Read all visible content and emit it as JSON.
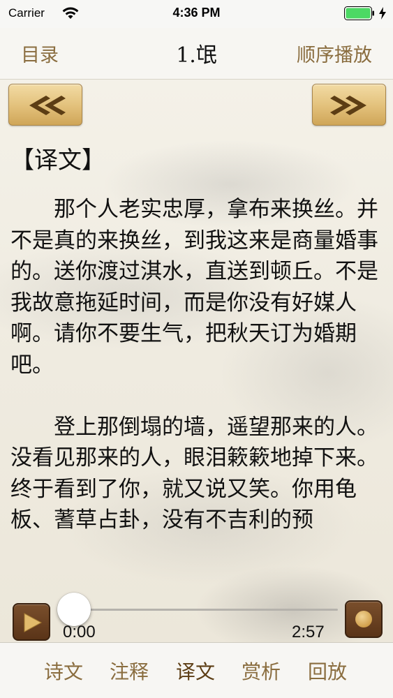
{
  "status_bar": {
    "carrier": "Carrier",
    "time": "4:36 PM",
    "icons": [
      "wifi-icon",
      "battery-icon",
      "charge-icon"
    ],
    "battery_color": "#4cd964"
  },
  "nav": {
    "left_label": "目录",
    "title": "1.氓",
    "right_label": "顺序播放",
    "accent_color": "#8a6d3f"
  },
  "content": {
    "prev_icon": "double-chevron-left-icon",
    "next_icon": "double-chevron-right-icon",
    "heading": "【译文】",
    "paragraphs": [
      "那个人老实忠厚，拿布来换丝。并不是真的来换丝，到我这来是商量婚事的。送你渡过淇水，直送到顿丘。不是我故意拖延时间，而是你没有好媒人啊。请你不要生气，把秋天订为婚期吧。",
      "登上那倒塌的墙，遥望那来的人。没看见那来的人，眼泪簌簌地掉下来。终于看到了你，就又说又笑。你用龟板、蓍草占卦，没有不吉利的预"
    ]
  },
  "player": {
    "current_time": "0:00",
    "total_time": "2:57",
    "progress": 0.0,
    "play_icon": "play-icon",
    "stop_icon": "stop-icon"
  },
  "tabs": [
    {
      "label": "诗文"
    },
    {
      "label": "注释"
    },
    {
      "label": "译文",
      "active": true
    },
    {
      "label": "赏析"
    },
    {
      "label": "回放"
    }
  ]
}
